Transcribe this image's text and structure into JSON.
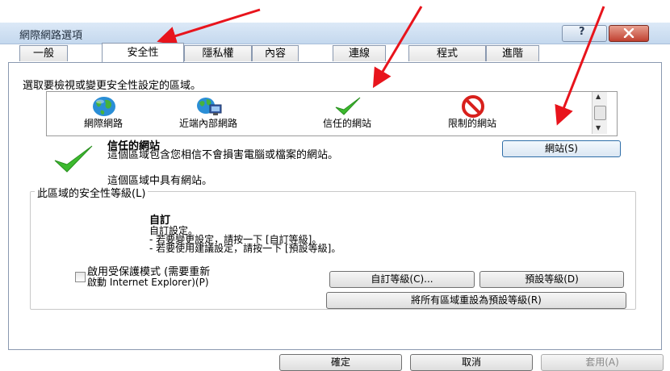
{
  "window": {
    "title": "網際網路選項",
    "help_label": "?"
  },
  "tabs": [
    {
      "label": "一般"
    },
    {
      "label": "安全性"
    },
    {
      "label": "隱私權"
    },
    {
      "label": "內容"
    },
    {
      "label": "連線"
    },
    {
      "label": "程式"
    },
    {
      "label": "進階"
    }
  ],
  "security": {
    "zone_prompt": "選取要檢視或變更安全性設定的區域。",
    "zones": [
      {
        "label": "網際網路",
        "icon": "globe-icon"
      },
      {
        "label": "近端內部網路",
        "icon": "intranet-icon"
      },
      {
        "label": "信任的網站",
        "icon": "checkmark-icon"
      },
      {
        "label": "限制的網站",
        "icon": "no-entry-icon"
      }
    ],
    "selected_zone": {
      "name": "信任的網站",
      "description": "這個區域包含您相信不會損害電腦或檔案的網站。",
      "has_sites": "這個區域中具有網站。"
    },
    "sites_button": "網站(S)",
    "level_group_label": "此區域的安全性等級(L)",
    "level_name": "自訂",
    "level_lines": [
      "自訂設定。",
      "- 若要變更設定，請按一下 [自訂等級]。",
      "- 若要使用建議設定，請按一下 [預設等級]。"
    ],
    "protected_mode_line1": "啟用受保護模式 (需要重新",
    "protected_mode_line2": "啟動 Internet Explorer)(P)",
    "custom_level_button": "自訂等級(C)...",
    "default_level_button": "預設等級(D)",
    "reset_all_button": "將所有區域重設為預設等級(R)"
  },
  "footer": {
    "ok": "確定",
    "cancel": "取消",
    "apply": "套用(A)"
  },
  "colors": {
    "annotation_arrow": "#e8141c",
    "title_bar": "#c4d8ee",
    "close_button": "#c04030",
    "check_green": "#3cba2e",
    "no_entry_red": "#d8201c"
  }
}
